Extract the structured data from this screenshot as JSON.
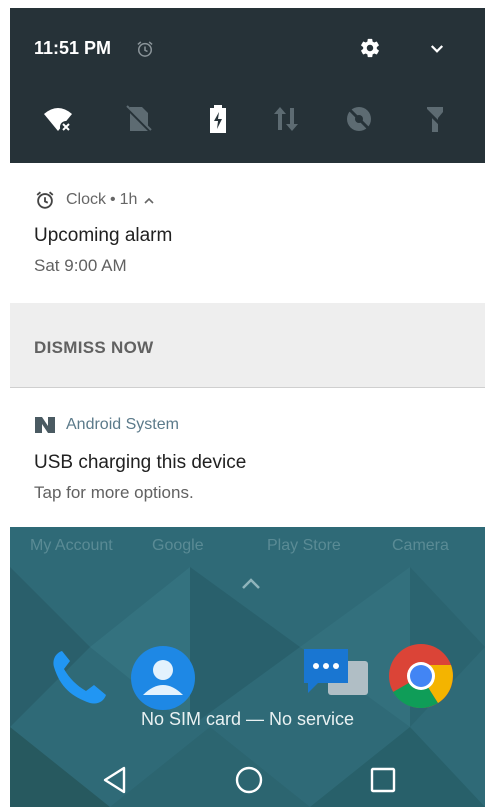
{
  "status": {
    "time": "11:51 PM"
  },
  "icons": {
    "alarm_status": "alarm-clock-icon",
    "settings": "gear-icon",
    "expand": "chevron-down-icon",
    "tiles": [
      "wifi-off-icon",
      "no-sim-icon",
      "battery-charging-icon",
      "data-arrows-icon",
      "location-off-icon",
      "flashlight-off-icon"
    ]
  },
  "notifications": [
    {
      "app": "Clock",
      "age": "1h",
      "title": "Upcoming alarm",
      "text": "Sat 9:00 AM",
      "action": "DISMISS NOW"
    },
    {
      "app": "Android System",
      "title": "USB charging this device",
      "text": "Tap for more options."
    }
  ],
  "home": {
    "app_labels": [
      "My Account",
      "Google",
      "Play Store",
      "Camera"
    ],
    "status_text": "No SIM card — No service"
  },
  "colors": {
    "header_bg": "#263238",
    "home_bg": "#2e6672"
  }
}
